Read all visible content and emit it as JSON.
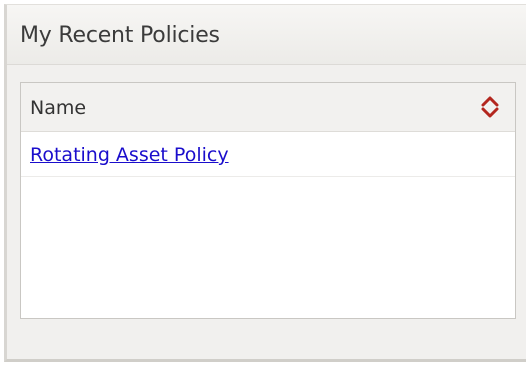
{
  "panel": {
    "title": "My Recent Policies"
  },
  "grid": {
    "columns": [
      {
        "label": "Name",
        "sort_icon": "sort-up-down-icon"
      }
    ],
    "rows": [
      {
        "name": "Rotating Asset Policy"
      }
    ]
  },
  "colors": {
    "link": "#1a0dcc",
    "sort_icon": "#b3261e",
    "header_bg": "#f2f1ef"
  }
}
